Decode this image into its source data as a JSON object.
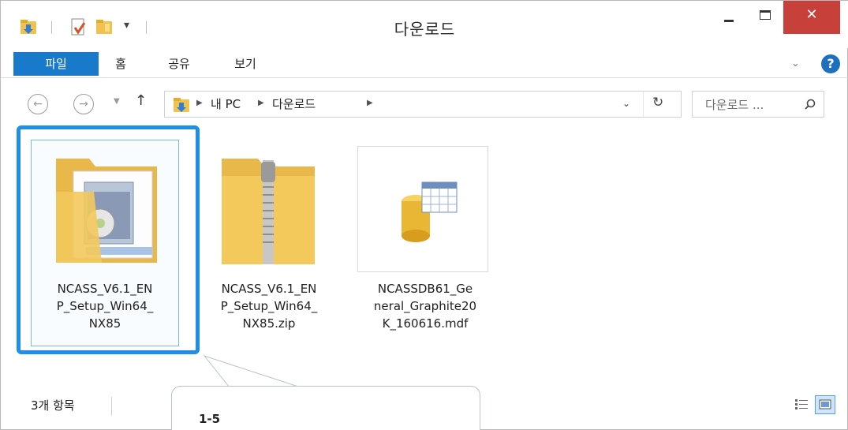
{
  "window": {
    "title": "다운로드",
    "close_glyph": "✕"
  },
  "ribbon": {
    "tabs": [
      "파일",
      "홈",
      "공유",
      "보기"
    ],
    "chevron": "⌄",
    "help": "?"
  },
  "nav": {
    "back": "←",
    "forward": "→",
    "recent": "▼",
    "up": "↑",
    "breadcrumbs": [
      "내 PC",
      "다운로드"
    ],
    "crumb_sep": "▶",
    "addr_dropdown": "⌄",
    "refresh": "↻",
    "search_placeholder": "다운로드 ..."
  },
  "files": [
    {
      "name_lines": [
        "NCASS_V6.1_EN",
        "P_Setup_Win64_",
        "NX85"
      ],
      "icon": "installer-folder-icon",
      "selected": true
    },
    {
      "name_lines": [
        "NCASS_V6.1_EN",
        "P_Setup_Win64_",
        "NX85.zip"
      ],
      "icon": "zip-folder-icon",
      "selected": false
    },
    {
      "name_lines": [
        "NCASSDB61_Ge",
        "neral_Graphite20",
        "K_160616.mdf"
      ],
      "icon": "database-file-icon",
      "selected": false
    }
  ],
  "status": {
    "item_count": "3개 항목"
  },
  "callout": {
    "text": "1-5"
  },
  "colors": {
    "accent": "#1979ca",
    "highlight": "#1f8ee8",
    "close": "#c8403a",
    "folder": "#f3c95c"
  }
}
